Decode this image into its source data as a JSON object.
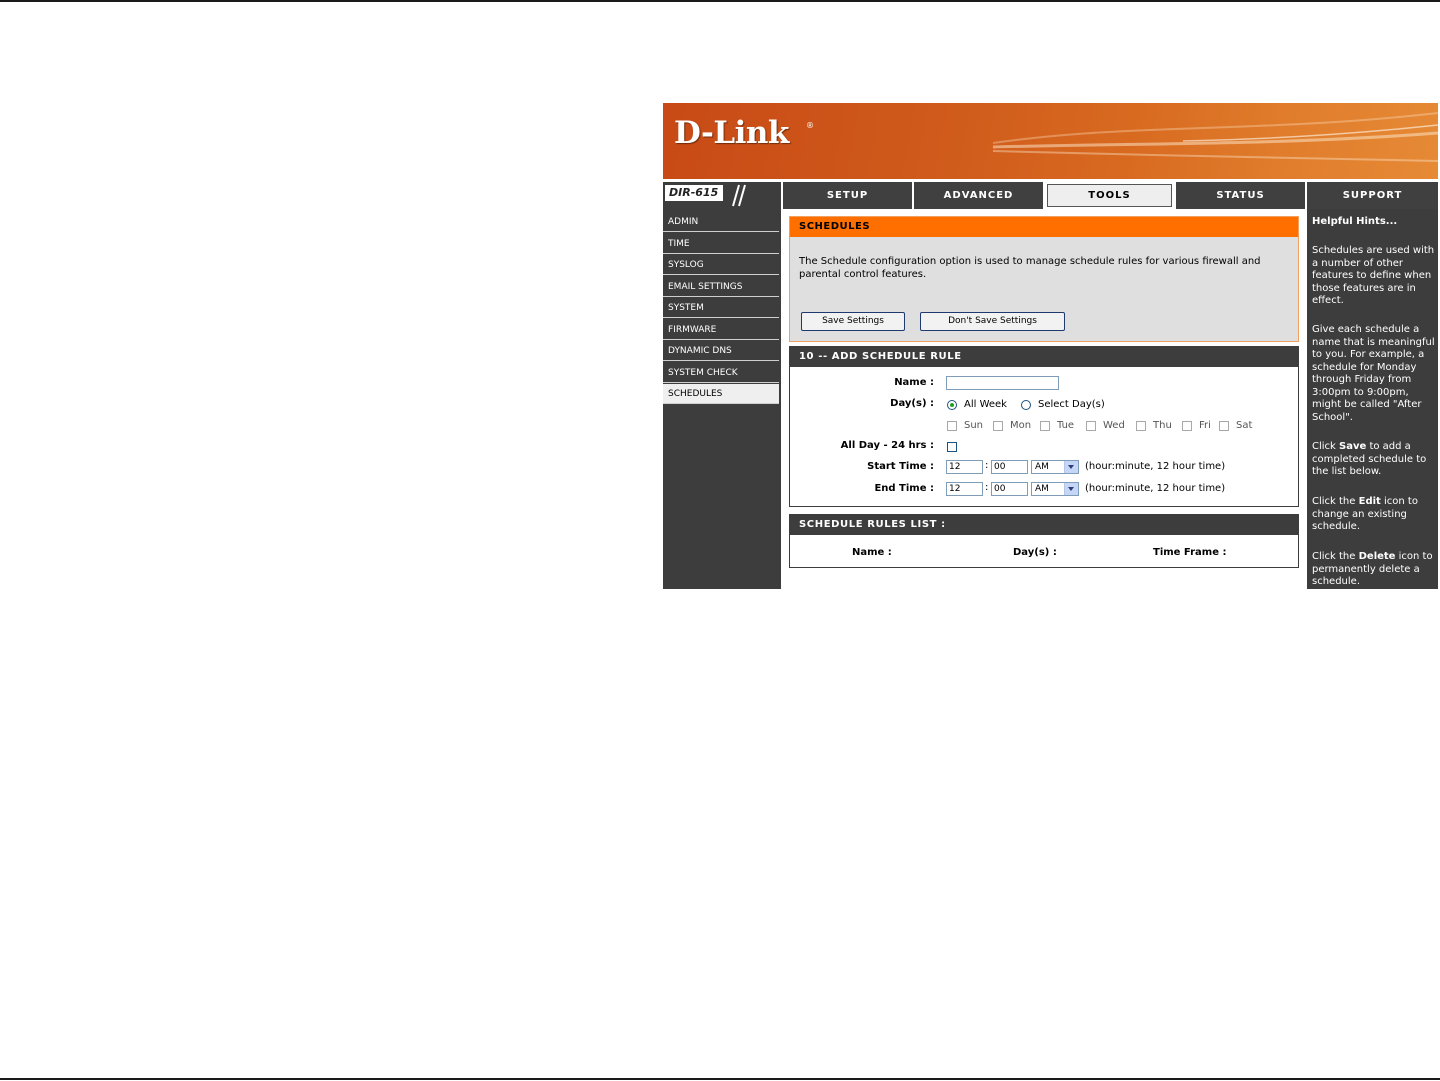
{
  "brand": {
    "logo_text": "D-Link",
    "registered": "®",
    "model": "DIR-615"
  },
  "tabs": [
    {
      "label": "SETUP",
      "active": false
    },
    {
      "label": "ADVANCED",
      "active": false
    },
    {
      "label": "TOOLS",
      "active": true
    },
    {
      "label": "STATUS",
      "active": false
    },
    {
      "label": "SUPPORT",
      "active": false
    }
  ],
  "sidebar": {
    "items": [
      {
        "label": "ADMIN"
      },
      {
        "label": "TIME"
      },
      {
        "label": "SYSLOG"
      },
      {
        "label": "EMAIL SETTINGS"
      },
      {
        "label": "SYSTEM"
      },
      {
        "label": "FIRMWARE"
      },
      {
        "label": "DYNAMIC DNS"
      },
      {
        "label": "SYSTEM CHECK"
      },
      {
        "label": "SCHEDULES",
        "active": true
      }
    ]
  },
  "schedules": {
    "title": "SCHEDULES",
    "description": "The Schedule configuration option is used to manage schedule rules for various firewall and parental control features.",
    "save_label": "Save Settings",
    "dont_save_label": "Don't Save Settings"
  },
  "add_rule": {
    "title": "10 -- ADD SCHEDULE RULE",
    "name_label": "Name :",
    "name_value": "",
    "days_label": "Day(s) :",
    "all_week_label": "All Week",
    "select_days_label": "Select Day(s)",
    "days_mode": "All Week",
    "days": [
      "Sun",
      "Mon",
      "Tue",
      "Wed",
      "Thu",
      "Fri",
      "Sat"
    ],
    "allday_label": "All Day - 24 hrs :",
    "allday_checked": false,
    "start_label": "Start Time :",
    "start_hour": "12",
    "start_minute": "00",
    "start_ampm": "AM",
    "end_label": "End Time :",
    "end_hour": "12",
    "end_minute": "00",
    "end_ampm": "AM",
    "time_sep": ":",
    "time_hint": "(hour:minute, 12 hour time)"
  },
  "rules_list": {
    "title": "SCHEDULE RULES LIST :",
    "col_name": "Name :",
    "col_days": "Day(s) :",
    "col_time": "Time Frame :"
  },
  "help": {
    "title": "Helpful Hints...",
    "p1": "Schedules are used with a number of other features to define when those features are in effect.",
    "p2": "Give each schedule a name that is meaningful to you. For example, a schedule for Monday through Friday from 3:00pm to 9:00pm, might be called \"After School\".",
    "p3_pre": "Click ",
    "p3_bold": "Save",
    "p3_post": " to add a completed schedule to the list below.",
    "p4_pre": "Click the ",
    "p4_bold": "Edit",
    "p4_post": " icon to change an existing schedule.",
    "p5_pre": "Click the ",
    "p5_bold": "Delete",
    "p5_post": " icon to permanently delete a schedule."
  },
  "colors": {
    "accent_orange": "#ff6f00",
    "nav_dark": "#3d3d3d",
    "panel_gray": "#dfdfdf"
  }
}
